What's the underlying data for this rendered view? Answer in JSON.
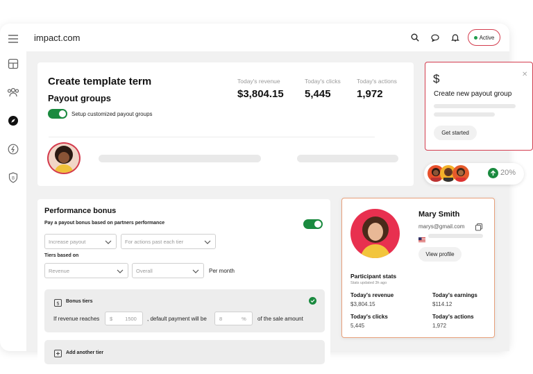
{
  "topbar": {
    "brand": "impact.com",
    "status_label": "Active"
  },
  "template": {
    "title": "Create template term",
    "subtitle": "Payout groups",
    "toggle_label": "Setup customized payout groups",
    "stats": [
      {
        "label": "Today's revenue",
        "value": "$3,804.15"
      },
      {
        "label": "Today's clicks",
        "value": "5,445"
      },
      {
        "label": "Today's actions",
        "value": "1,972"
      }
    ]
  },
  "payout_popup": {
    "icon_text": "$",
    "title": "Create new payout group",
    "button": "Get started"
  },
  "growth_badge": {
    "value": "20%"
  },
  "bonus": {
    "title": "Performance bonus",
    "description": "Pay a payout bonus based on partners performance",
    "select1_placeholder": "Increase payout",
    "select2_placeholder": "For actions past each tier",
    "tiers_label": "Tiers based on",
    "select3_placeholder": "Revenue",
    "select4_placeholder": "Overall",
    "per_month": "Per month",
    "tiers_title": "Bonus tiers",
    "if_revenue": "If revenue reaches",
    "currency": "$",
    "amount": "1500",
    "default_payment": ", default payment will be",
    "percent_value": "8",
    "percent_sign": "%",
    "of_sale": "of the sale amount",
    "add_tier": "Add another tier"
  },
  "profile": {
    "name": "Mary Smith",
    "email": "marys@gmail.com",
    "button": "View profile",
    "stats_title": "Participant stats",
    "stats_updated": "Stats updated 3h ago",
    "stats": [
      {
        "label": "Today's revenue",
        "value": "$3,804.15"
      },
      {
        "label": "Today's earnings",
        "value": "$114.12"
      },
      {
        "label": "Today's clicks",
        "value": "5,445"
      },
      {
        "label": "Today's actions",
        "value": "1,972"
      }
    ]
  },
  "colors": {
    "accent_red": "#d33b4d",
    "green": "#1a8a3f",
    "background": "#f1f1f1"
  }
}
